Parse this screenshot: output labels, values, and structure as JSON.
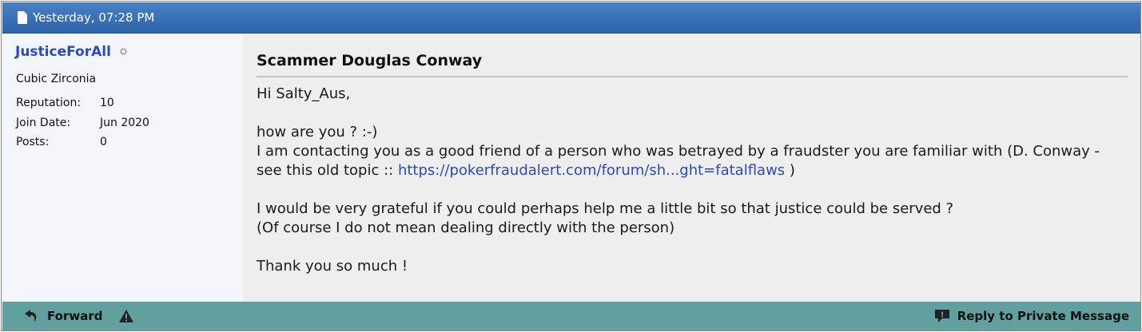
{
  "header": {
    "date": "Yesterday, 07:28 PM",
    "icon": "document-icon"
  },
  "user": {
    "name": "JusticeForAll",
    "status_icon": "offline-status-icon",
    "rank": "Cubic Zirconia",
    "stats": [
      {
        "label": "Reputation:",
        "value": "10"
      },
      {
        "label": "Join Date:",
        "value": "Jun 2020"
      },
      {
        "label": "Posts:",
        "value": "0"
      }
    ]
  },
  "message": {
    "title": "Scammer Douglas Conway",
    "greeting": "Hi Salty_Aus,",
    "line1": "how are you ? :-)",
    "line2_pre": "I am contacting you as a good friend of a person who was betrayed by a fraudster you are familiar with (D. Conway - see this old topic :: ",
    "link": "https://pokerfraudalert.com/forum/sh...ght=fatalflaws",
    "line2_post": " )",
    "line3": "I would be very grateful if you could perhaps help me a little bit so that justice could be served ?",
    "line4": "(Of course I do not mean dealing directly with the person)",
    "closing": "Thank you so much !"
  },
  "footer": {
    "forward_label": "Forward",
    "reply_label": "Reply to Private Message"
  },
  "colors": {
    "header_blue": "#2d63aa",
    "username_blue": "#2c48c2",
    "footer_teal": "#62a0a0"
  }
}
